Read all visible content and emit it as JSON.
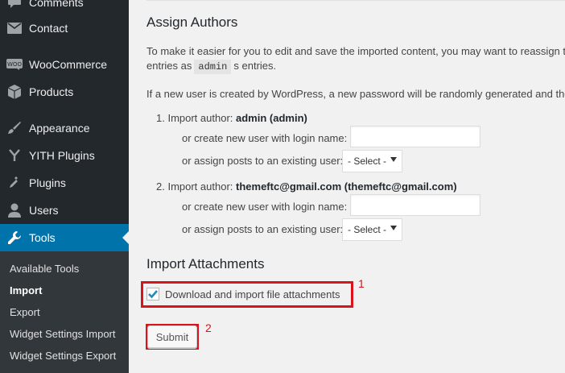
{
  "sidebar": {
    "menu": [
      {
        "label": "Comments",
        "icon": "speech-bubble-icon"
      },
      {
        "label": "Contact",
        "icon": "envelope-icon"
      },
      {
        "label": "WooCommerce",
        "icon": "woocommerce-icon"
      },
      {
        "label": "Products",
        "icon": "box-icon"
      },
      {
        "label": "Appearance",
        "icon": "paintbrush-icon"
      },
      {
        "label": "YITH Plugins",
        "icon": "yith-icon"
      },
      {
        "label": "Plugins",
        "icon": "plug-icon"
      },
      {
        "label": "Users",
        "icon": "user-icon"
      },
      {
        "label": "Tools",
        "icon": "wrench-icon"
      }
    ],
    "submenu": [
      "Available Tools",
      "Import",
      "Export",
      "Widget Settings Import",
      "Widget Settings Export"
    ]
  },
  "assign": {
    "title": "Assign Authors",
    "para1_a": "To make it easier for you to edit and save the imported content, you may want to reassign t",
    "para1_b1": "entries as",
    "para1_code": "admin",
    "para1_b2": "s entries.",
    "para2": "If a new user is created by WordPress, a new password will be randomly generated and the",
    "authors": [
      {
        "prefix": "1. Import author:",
        "name": "admin (admin)"
      },
      {
        "prefix": "2. Import author:",
        "name": "themeftc@gmail.com (themeftc@gmail.com)"
      }
    ],
    "create_label": "or create new user with login name:",
    "assign_label": "or assign posts to an existing user:",
    "select_value": "- Select -"
  },
  "attachments": {
    "title": "Import Attachments",
    "checkbox_label": "Download and import file attachments",
    "checked": true
  },
  "submit_label": "Submit",
  "annotations": [
    "1",
    "2"
  ],
  "colors": {
    "sidebar_bg": "#23282d",
    "submenu_bg": "#32373c",
    "active_bg": "#0073aa",
    "highlight": "#d9141c",
    "check": "#1e8cbe"
  }
}
